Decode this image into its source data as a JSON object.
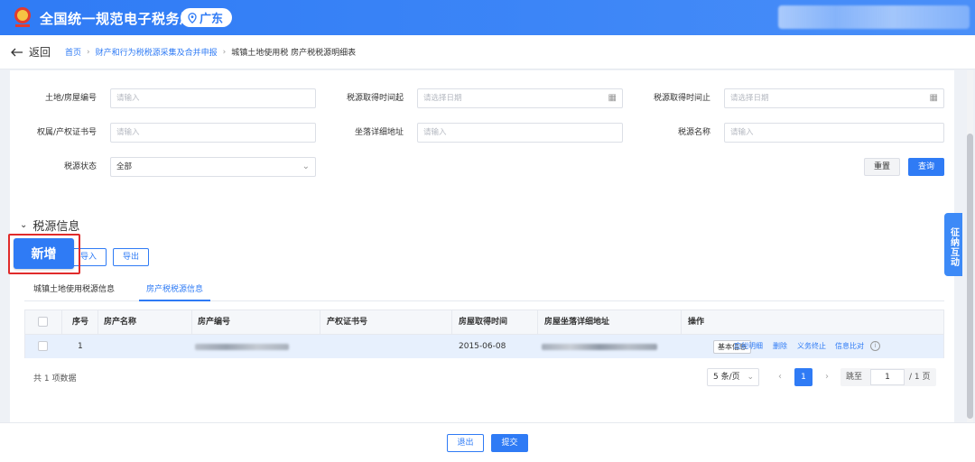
{
  "header": {
    "app_title": "全国统一规范电子税务局",
    "region": "广东",
    "brand_color": "#2f7bf5"
  },
  "nav": {
    "back_label": "返回",
    "breadcrumbs": [
      "首页",
      "财产和行为税税源采集及合并申报",
      "城镇土地使用税 房产税税源明细表"
    ]
  },
  "filters": {
    "land_house_no": {
      "label": "土地/房屋编号",
      "placeholder": "请输入"
    },
    "acquire_start": {
      "label": "税源取得时间起",
      "placeholder": "请选择日期"
    },
    "acquire_end": {
      "label": "税源取得时间止",
      "placeholder": "请选择日期"
    },
    "property_cert_no": {
      "label": "权属/产权证书号",
      "placeholder": "请输入"
    },
    "address": {
      "label": "坐落详细地址",
      "placeholder": "请输入"
    },
    "source_name": {
      "label": "税源名称",
      "placeholder": "请输入"
    },
    "status": {
      "label": "税源状态",
      "value": "全部"
    },
    "reset_label": "重置",
    "query_label": "查询"
  },
  "section": {
    "title": "税源信息",
    "add_label": "新增",
    "import_label": "导入",
    "export_label": "导出"
  },
  "tabs": [
    "城镇土地使用税源信息",
    "房产税税源信息"
  ],
  "active_tab": 1,
  "table": {
    "headers": [
      "序号",
      "房产名称",
      "房产编号",
      "产权证书号",
      "房屋取得时间",
      "房屋坐落详细地址",
      "操作"
    ],
    "rows": [
      {
        "index": "1",
        "name": "",
        "code_redacted": true,
        "cert_no": "",
        "acquire_date": "2015-06-08",
        "address_redacted": true,
        "actions": [
          "基本信息",
          "应税明细",
          "删除",
          "义务终止",
          "信息比对"
        ]
      }
    ]
  },
  "pagination": {
    "total_text": "共 1 项数据",
    "page_size": "5 条/页",
    "current_page": "1",
    "jump_label": "跳至",
    "jump_value": "1",
    "page_total": "/ 1 页"
  },
  "side_float": {
    "label": "征纳互动"
  },
  "footer": {
    "exit_label": "退出",
    "submit_label": "提交"
  }
}
